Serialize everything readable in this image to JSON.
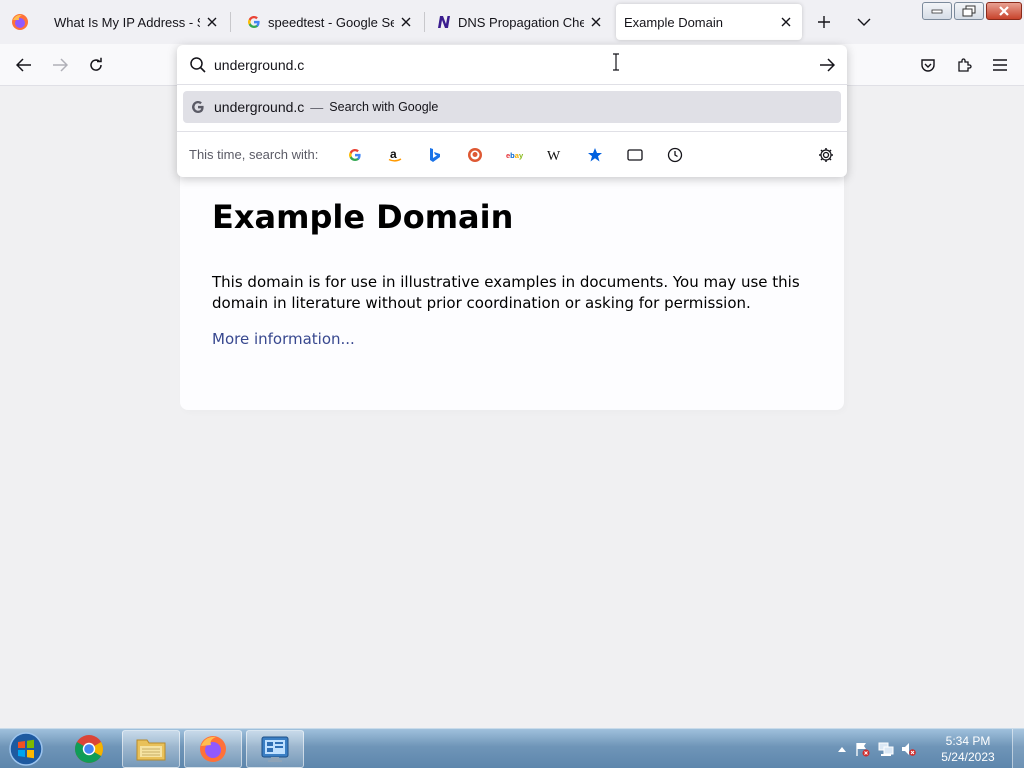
{
  "tabs": [
    {
      "title": "What Is My IP Address - See Your",
      "favicon": "firefox-tab-icon"
    },
    {
      "title": "speedtest - Google Search",
      "favicon": "google-g-icon"
    },
    {
      "title": "DNS Propagation Checker",
      "favicon": "n-logo-icon"
    },
    {
      "title": "Example Domain",
      "favicon": "none",
      "active": true
    }
  ],
  "urlbar": {
    "value": "underground.c",
    "suggestion": {
      "query": "underground.c",
      "separator": "—",
      "action": "Search with Google"
    },
    "one_off_label": "This time, search with:",
    "engines": [
      "Google",
      "Amazon",
      "Bing",
      "DuckDuckGo",
      "eBay",
      "Wikipedia",
      "Bookmarks",
      "Tabs",
      "History"
    ]
  },
  "page": {
    "heading": "Example Domain",
    "paragraph": "This domain is for use in illustrative examples in documents. You may use this domain in literature without prior coordination or asking for permission.",
    "link": "More information..."
  },
  "taskbar": {
    "time": "5:34 PM",
    "date": "5/24/2023"
  },
  "colors": {
    "link": "#38488f",
    "suggest_highlight": "#e0e0e6",
    "bookmark_star": "#0060df"
  }
}
